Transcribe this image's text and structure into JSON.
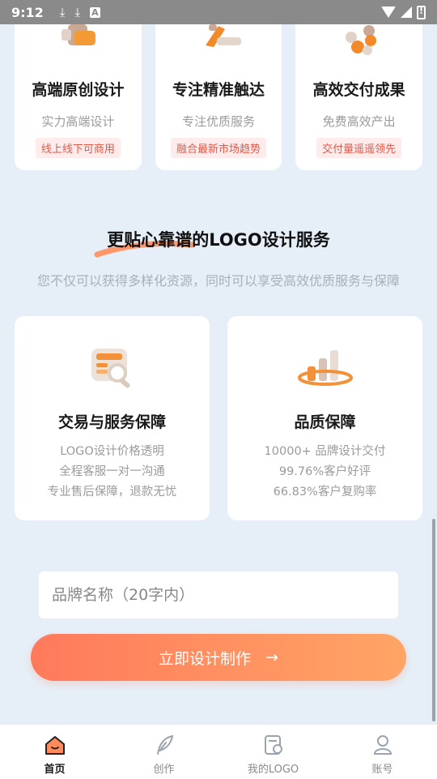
{
  "status_bar": {
    "time": "9:12"
  },
  "features": [
    {
      "title": "高端原创设计",
      "sub": "实力高端设计",
      "tag": "线上线下可商用"
    },
    {
      "title": "专注精准触达",
      "sub": "专注优质服务",
      "tag": "融合最新市场趋势"
    },
    {
      "title": "高效交付成果",
      "sub": "免费高效产出",
      "tag": "交付量遥遥领先"
    }
  ],
  "section": {
    "title": "更贴心靠谱的LOGO设计服务",
    "subtitle": "您不仅可以获得多样化资源，同时可以享受高效优质服务与保障"
  },
  "guarantees": [
    {
      "title": "交易与服务保障",
      "lines": [
        "LOGO设计价格透明",
        "全程客服一对一沟通",
        "专业售后保障，退款无忧"
      ]
    },
    {
      "title": "品质保障",
      "lines": [
        "10000+ 品牌设计交付",
        "99.76%客户好评",
        "66.83%客户复购率"
      ]
    }
  ],
  "form": {
    "brand_placeholder": "品牌名称（20字内）",
    "brand_value": "",
    "cta_label": "立即设计制作",
    "cta_arrow": "→"
  },
  "nav": [
    {
      "label": "首页",
      "icon": "home-icon",
      "active": true
    },
    {
      "label": "创作",
      "icon": "feather-icon",
      "active": false
    },
    {
      "label": "我的LOGO",
      "icon": "logo-doc-icon",
      "active": false
    },
    {
      "label": "账号",
      "icon": "user-icon",
      "active": false
    }
  ],
  "colors": {
    "accent": "#ff7a5c",
    "accent_end": "#ffa565",
    "tag_text": "#e05a4a",
    "tag_bg": "#fdeceb",
    "page_bg": "#e6eff8"
  }
}
